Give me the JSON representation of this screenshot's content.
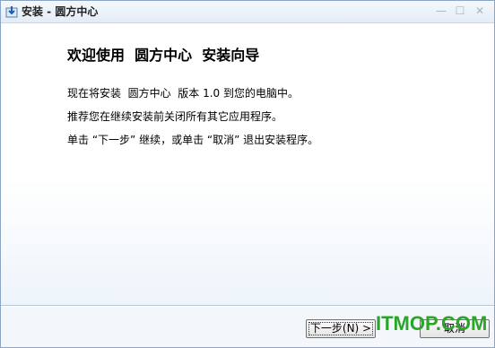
{
  "window": {
    "title": "安装 - 圆方中心",
    "controls": {
      "minimize": "—",
      "maximize": "☐",
      "close": "✕"
    }
  },
  "main": {
    "heading": "欢迎使用  圆方中心  安装向导",
    "paragraphs": [
      "现在将安装  圆方中心  版本 1.0 到您的电脑中。",
      "推荐您在继续安装前关闭所有其它应用程序。",
      "单击 “下一步” 继续，或单击 “取消” 退出安装程序。"
    ]
  },
  "footer": {
    "next_label": "下一步(N) >",
    "cancel_label": "取消",
    "watermark": "ITMOP.COM"
  },
  "colors": {
    "watermark": "#2aa52a",
    "title_bar": "#e3ecf6",
    "border": "#8aa6c4"
  }
}
